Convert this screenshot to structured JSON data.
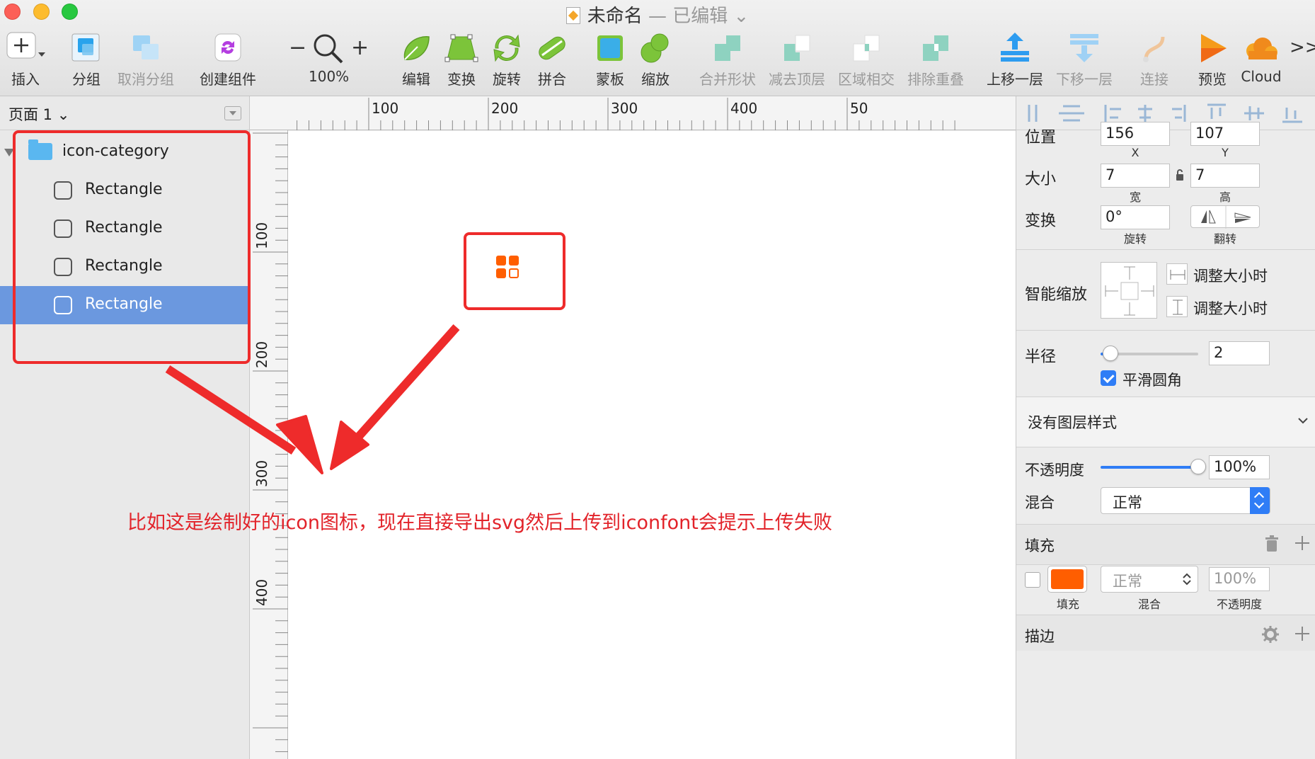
{
  "window": {
    "title": "未命名",
    "edited": "— 已编辑",
    "chevron": "⌄"
  },
  "toolbar": {
    "insert": "插入",
    "group": "分组",
    "ungroup": "取消分组",
    "create_symbol": "创建组件",
    "zoom_minus": "−",
    "zoom_value": "100%",
    "zoom_plus": "+",
    "edit": "编辑",
    "transform": "变换",
    "rotate": "旋转",
    "flatten": "拼合",
    "mask": "蒙板",
    "scale": "缩放",
    "union": "合并形状",
    "subtract": "减去顶层",
    "intersect": "区域相交",
    "difference": "排除重叠",
    "forward": "上移一层",
    "backward": "下移一层",
    "link": "连接",
    "preview": "预览",
    "cloud": "Cloud",
    "more": ">>"
  },
  "layers": {
    "page_label": "页面 1",
    "page_chevron": "⌄",
    "group_name": "icon-category",
    "items": [
      {
        "name": "Rectangle",
        "selected": false
      },
      {
        "name": "Rectangle",
        "selected": false
      },
      {
        "name": "Rectangle",
        "selected": false
      },
      {
        "name": "Rectangle",
        "selected": true
      }
    ]
  },
  "rulers": {
    "h_labels": [
      "100",
      "200",
      "300",
      "400",
      "50"
    ],
    "v_labels": [
      "100",
      "200",
      "300",
      "400"
    ]
  },
  "inspector": {
    "position_label": "位置",
    "x_value": "156",
    "y_value": "107",
    "x_sub": "X",
    "y_sub": "Y",
    "size_label": "大小",
    "width_value": "7",
    "height_value": "7",
    "width_sub": "宽",
    "height_sub": "高",
    "transform_label": "变换",
    "rotation_value": "0°",
    "rotation_sub": "旋转",
    "flip_sub": "翻转",
    "resizing_label": "智能缩放",
    "resize_width": "调整大小时",
    "resize_height": "调整大小时",
    "radius_label": "半径",
    "radius_value": "2",
    "radius_fraction": 0.1,
    "smooth_corners": "平滑圆角",
    "shared_style": "没有图层样式",
    "opacity_label": "不透明度",
    "opacity_value": "100%",
    "opacity_fraction": 1.0,
    "blend_label": "混合",
    "blend_value": "正常",
    "fills_label": "填充",
    "fill_color": "#ff5e00",
    "fill_sub": "填充",
    "fill_blend_value": "正常",
    "fill_blend_sub": "混合",
    "fill_opacity_value": "100%",
    "fill_opacity_sub": "不透明度",
    "borders_label": "描边"
  },
  "annotation": {
    "text": "比如这是绘制好的icon图标，现在直接导出svg然后上传到iconfont会提示上传失败"
  },
  "colors": {
    "accent_blue": "#2f7df6",
    "selection": "#6b98df",
    "annotation_red": "#ee2b2b",
    "icon_orange": "#ff5e00"
  }
}
